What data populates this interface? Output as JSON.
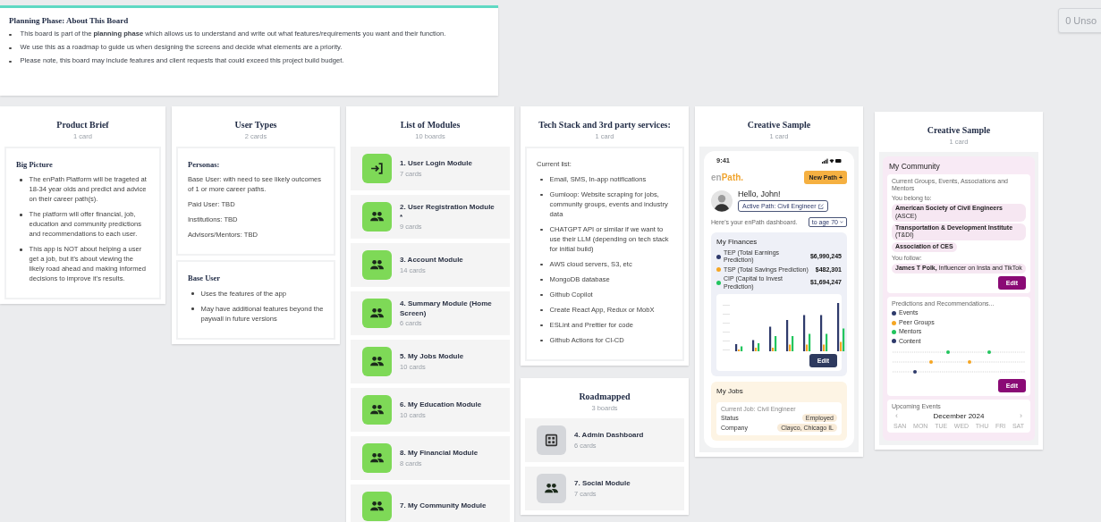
{
  "about_note": {
    "title": "Planning Phase: About This Board",
    "bullets": [
      "This board is part of the **planning phase** which allows us to understand and write out what features/requirements you want and their function.",
      "We use this as a roadmap to guide us when designing the screens and decide what elements are a priority.",
      "Please note, this board may include features and client requests that could exceed this project build budget."
    ]
  },
  "unsorted_button": "0 Unso",
  "columns": [
    {
      "lists": [
        {
          "title": "Product Brief",
          "count": "1 card",
          "cards": [
            {
              "kind": "note",
              "heading": "Big Picture",
              "bullets": [
                "The enPath Platform will be trageted at 18-34 year olds and predict and advice on their career path(s).",
                "The platform will offer financial, job, education and community predictions and recommendations to each user.",
                "This app is NOT about helping a user get a job, but it's about viewing the likely road ahead and making informed decisions to improve it's results."
              ]
            }
          ]
        }
      ]
    },
    {
      "lists": [
        {
          "title": "User Types",
          "count": "2 cards",
          "cards": [
            {
              "kind": "note",
              "heading": "Personas:",
              "lines": [
                "Base User:  with need to see likely outcomes of 1 or more career paths.",
                "Paid User: TBD",
                "Institutions: TBD",
                "Advisors/Mentors: TBD"
              ]
            },
            {
              "kind": "note",
              "heading": "Base User",
              "bullets": [
                "Uses the features of the app",
                "May have additional features beyond the paywall in future versions"
              ]
            }
          ]
        }
      ]
    },
    {
      "lists": [
        {
          "title": "List of Modules",
          "count": "10 boards",
          "cards": [
            {
              "kind": "login_board",
              "color": "#7ed957",
              "title": "1. User Login Module",
              "count": "7 cards"
            },
            {
              "kind": "people_board",
              "color": "#7ed957",
              "title": "2. User Registration Module *",
              "count": "9 cards"
            },
            {
              "kind": "people_board",
              "color": "#7ed957",
              "title": "3. Account Module",
              "count": "14 cards"
            },
            {
              "kind": "people_board",
              "color": "#7ed957",
              "title": "4. Summary Module (Home Screen)",
              "count": "6 cards"
            },
            {
              "kind": "people_board",
              "color": "#7ed957",
              "title": "5. My Jobs Module",
              "count": "10 cards"
            },
            {
              "kind": "people_board",
              "color": "#7ed957",
              "title": "6. My Education Module",
              "count": "10 cards"
            },
            {
              "kind": "people_board",
              "color": "#7ed957",
              "title": "8. My Financial Module",
              "count": "8 cards"
            },
            {
              "kind": "people_board",
              "color": "#7ed957",
              "title": "7. My Community Module"
            }
          ]
        }
      ]
    },
    {
      "lists": [
        {
          "title": "Tech Stack and 3rd party services:",
          "count": "1 card",
          "cards": [
            {
              "kind": "note",
              "lines": [
                "Current list:"
              ],
              "bullets": [
                "Email, SMS, In-app notifications",
                "Gumloop: Website scraping for jobs, community groups, events and industry data",
                "CHATGPT API or similar if we want to use their LLM (depending on tech stack for initial build)",
                "AWS cloud servers, S3, etc",
                "MongoDB database",
                "Github Copilot",
                "Create React App, Redux or MobX",
                "ESLint and Prettier for code",
                "Github Actions for CI-CD"
              ]
            }
          ]
        },
        {
          "title": "Roadmapped",
          "count": "3 boards",
          "cards": [
            {
              "kind": "grid_board",
              "color": "#d4d6da",
              "title": "4. Admin Dashboard",
              "count": "6 cards"
            },
            {
              "kind": "people_board",
              "color": "#d4d6da",
              "title": "7. Social Module",
              "count": "7 cards"
            }
          ]
        }
      ]
    },
    {
      "lists": [
        {
          "title": "Creative Sample",
          "count": "1 card",
          "cards": [
            {
              "kind": "finance_mockup",
              "time": "9:41",
              "logo": {
                "lead": "en",
                "accent": "Path."
              },
              "new_path_button": "New Path +",
              "greeting": "Hello, John!",
              "active_path": "Active Path: Civil Engineer",
              "dashboard_text": "Here's your enPath dashboard.",
              "age_select": "to age 70",
              "finances": {
                "title": "My Finances",
                "legend": [
                  {
                    "label": "TEP (Total Earnings Prediction)",
                    "value": "$6,990,245",
                    "color": "#2e3a6b"
                  },
                  {
                    "label": "TSP (Total Savings Prediction)",
                    "value": "$482,301",
                    "color": "#f5a623"
                  },
                  {
                    "label": "CIP (Capital to Invest Prediction)",
                    "value": "$1,694,247",
                    "color": "#22c55e"
                  }
                ],
                "edit_button": "Edit"
              },
              "jobs": {
                "title": "My Jobs",
                "subtitle": "Current Job: Civil Engineer",
                "rows": [
                  {
                    "label": "Status",
                    "value": "Employed"
                  },
                  {
                    "label": "Company",
                    "value": "Clayco, Chicago IL"
                  }
                ]
              }
            }
          ]
        }
      ]
    },
    {
      "lists": [
        {
          "title": "Creative Sample",
          "count": "1 card",
          "cards": [
            {
              "kind": "community_mockup",
              "title": "My Community",
              "groups": {
                "subtitle": "Current Groups, Events, Associations and Mentors",
                "belong_label": "You belong to:",
                "belong": [
                  {
                    "name": "American Society of Civil Engineers",
                    "note": "(ASCE)"
                  },
                  {
                    "name": "Transportation & Development Institute",
                    "note": "(T&DI)"
                  },
                  {
                    "name": "Association of CES"
                  }
                ],
                "follow_label": "You follow:",
                "follow": [
                  {
                    "name": "James T Polk,",
                    "note": "Influencer on Insta and TikTok"
                  }
                ],
                "edit_button": "Edit"
              },
              "predictions": {
                "title": "Predictions and Recommendations...",
                "legend": [
                  {
                    "label": "Events",
                    "color": "#2e3a6b"
                  },
                  {
                    "label": "Peer Groups",
                    "color": "#f5a623"
                  },
                  {
                    "label": "Mentors",
                    "color": "#22c55e"
                  },
                  {
                    "label": "Content",
                    "color": "#2e3a6b"
                  }
                ],
                "edit_button": "Edit"
              },
              "events": {
                "title": "Upcoming Events",
                "prev": "‹",
                "month": "December 2024",
                "next": "›",
                "weekdays": [
                  "SAN",
                  "MON",
                  "TUE",
                  "WED",
                  "THU",
                  "FRI",
                  "SAT"
                ]
              }
            }
          ]
        }
      ]
    }
  ]
}
